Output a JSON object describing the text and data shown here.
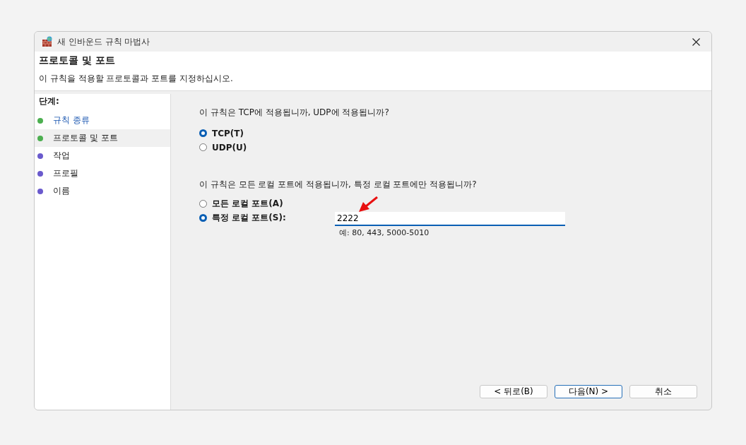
{
  "window": {
    "title": "새 인바운드 규칙 마법사"
  },
  "header": {
    "title": "프로토콜 및 포트",
    "subtitle": "이 규칙을 적용할 프로토콜과 포트를 지정하십시오."
  },
  "steps": {
    "heading": "단계:",
    "items": [
      {
        "label": "규칙 종류",
        "kind": "link",
        "selected": false,
        "color": "#4caf50"
      },
      {
        "label": "프로토콜 및 포트",
        "kind": "plain",
        "selected": true,
        "color": "#4caf50"
      },
      {
        "label": "작업",
        "kind": "plain",
        "selected": false,
        "color": "#6a5acd"
      },
      {
        "label": "프로필",
        "kind": "plain",
        "selected": false,
        "color": "#6a5acd"
      },
      {
        "label": "이름",
        "kind": "plain",
        "selected": false,
        "color": "#6a5acd"
      }
    ]
  },
  "protocol": {
    "question": "이 규칙은 TCP에 적용됩니까, UDP에 적용됩니까?",
    "options": [
      {
        "label": "TCP(T)",
        "selected": true
      },
      {
        "label": "UDP(U)",
        "selected": false
      }
    ]
  },
  "ports": {
    "question": "이 규칙은 모든 로컬 포트에 적용됩니까, 특정 로컬 포트에만 적용됩니까?",
    "options": [
      {
        "label": "모든 로컬 포트(A)",
        "selected": false
      },
      {
        "label": "특정 로컬 포트(S):",
        "selected": true
      }
    ],
    "field": {
      "value": "2222",
      "hint": "예: 80, 443, 5000-5010"
    }
  },
  "buttons": [
    {
      "label": "< 뒤로(B)",
      "default": false
    },
    {
      "label": "다음(N) >",
      "default": true
    },
    {
      "label": "취소",
      "default": false
    }
  ]
}
